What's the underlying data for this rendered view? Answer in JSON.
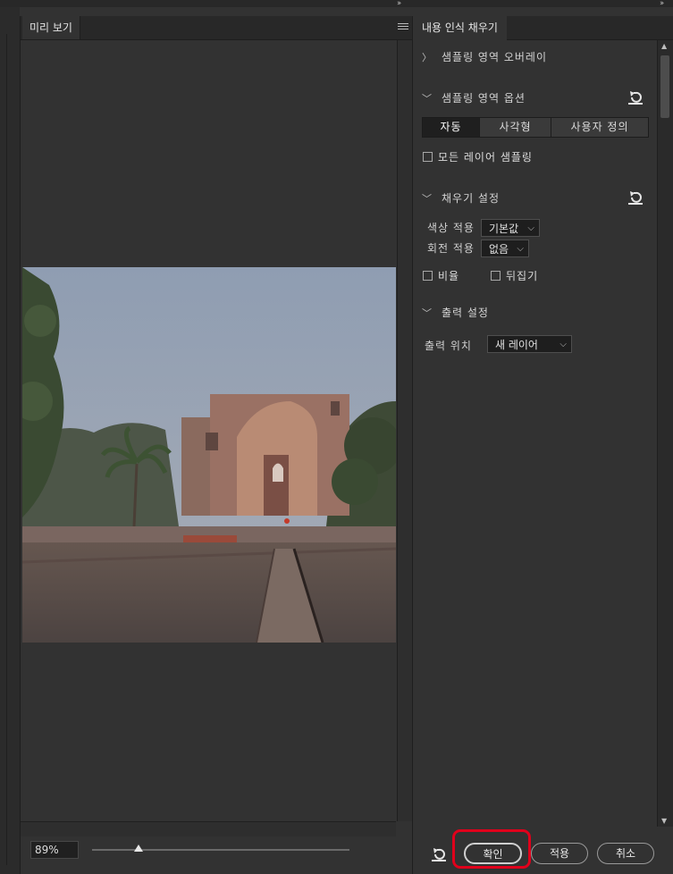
{
  "preview_panel": {
    "tab_label": "미리 보기",
    "zoom_value": "89%",
    "zoom_slider_fraction": 0.18
  },
  "settings_panel": {
    "tab_label": "내용 인식 채우기",
    "sampling_overlay": {
      "label": "샘플링 영역 오버레이"
    },
    "sampling_options": {
      "label": "샘플링 영역 옵션",
      "modes": [
        "자동",
        "사각형",
        "사용자 정의"
      ],
      "selected_mode": "자동",
      "sample_all_layers": "모든 레이어 샘플링"
    },
    "fill_settings": {
      "label": "채우기 설정",
      "color_adaptation_label": "색상 적용",
      "color_adaptation_value": "기본값",
      "rotation_adaptation_label": "회전 적용",
      "rotation_adaptation_value": "없음",
      "scale_label": "비율",
      "mirror_label": "뒤집기"
    },
    "output_settings": {
      "label": "출력 설정",
      "output_to_label": "출력 위치",
      "output_to_value": "새 레이어"
    },
    "buttons": {
      "ok": "확인",
      "apply": "적용",
      "cancel": "취소"
    }
  },
  "colors": {
    "highlight": "#e0001b",
    "panel_bg": "#323232"
  }
}
